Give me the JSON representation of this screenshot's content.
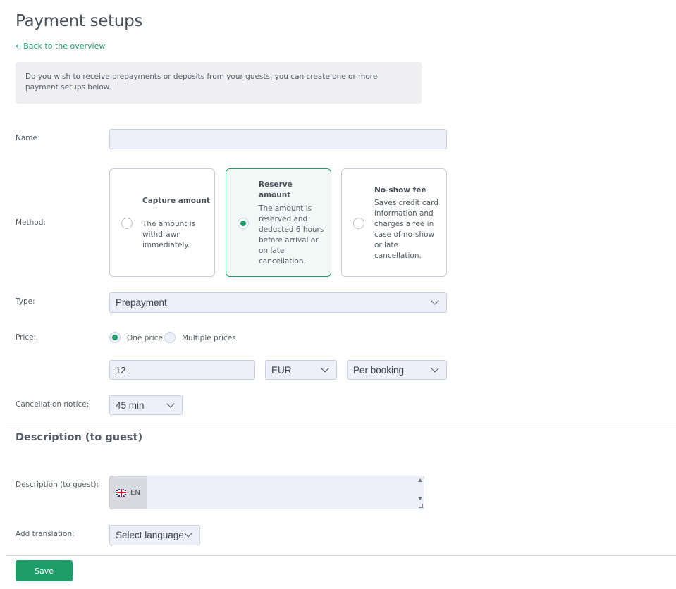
{
  "header": {
    "title": "Payment setups",
    "back_arrow": "←",
    "back_label": "Back to the overview"
  },
  "info": {
    "text": "Do you wish to receive prepayments or deposits from your guests, you can create one or more payment setups below."
  },
  "form": {
    "name_label": "Name:",
    "name_value": "",
    "method_label": "Method:",
    "methods": [
      {
        "title": "Capture amount",
        "description": "The amount is withdrawn immediately.",
        "selected": false
      },
      {
        "title": "Reserve amount",
        "description": "The amount is reserved and deducted 6 hours before arrival or on late cancellation.",
        "selected": true
      },
      {
        "title": "No-show fee",
        "description": "Saves credit card information and charges a fee in case of no-show or late cancellation.",
        "selected": false
      }
    ],
    "type_label": "Type:",
    "type_value": "Prepayment",
    "price_label": "Price:",
    "price_options": [
      "One price",
      "Multiple prices"
    ],
    "price_selected": "One price",
    "price_value": "12",
    "currency_value": "EUR",
    "per_value": "Per booking",
    "cancellation_label": "Cancellation notice:",
    "cancellation_value": "45 min"
  },
  "description_section": {
    "title": "Description (to guest)",
    "field_label": "Description (to guest):",
    "language_code": "EN",
    "language_flag_icon": "uk-flag-icon",
    "value": "",
    "add_translation_label": "Add translation:",
    "select_language_value": "Select language"
  },
  "actions": {
    "save_label": "Save"
  },
  "colors": {
    "accent": "#1f9d69",
    "input_bg": "#eef0f9",
    "info_bg": "#efeff1"
  }
}
